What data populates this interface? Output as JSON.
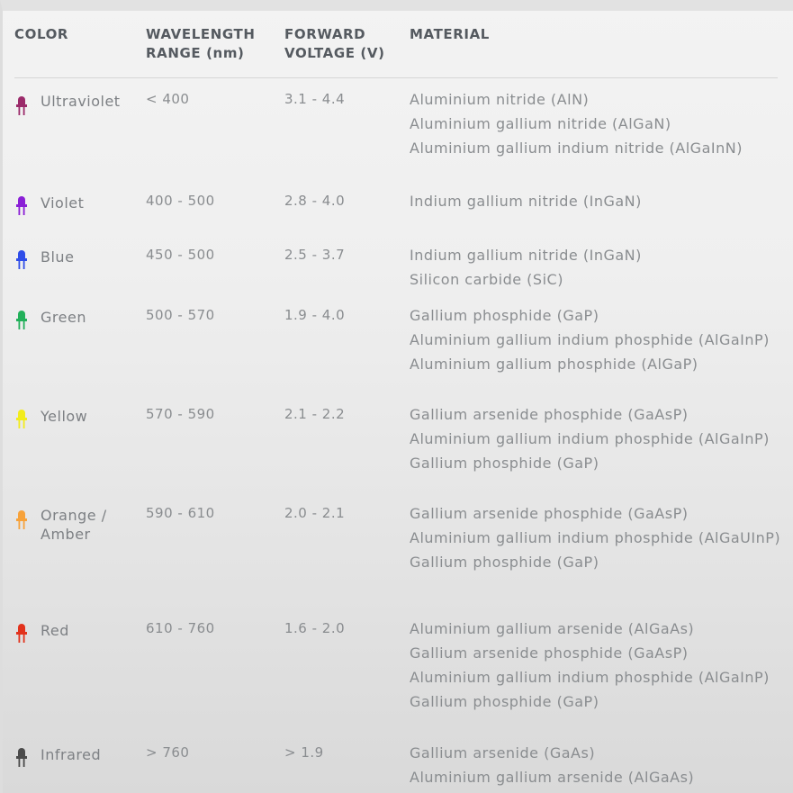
{
  "headers": {
    "color": [
      "COLOR"
    ],
    "wavelength": [
      "WAVELENGTH",
      "RANGE (nm)"
    ],
    "voltage": [
      "FORWARD",
      "VOLTAGE (V)"
    ],
    "material": [
      "MATERIAL"
    ]
  },
  "rows": [
    {
      "name": "Ultraviolet",
      "led_color": "#9b2a6a",
      "wavelength": "< 400",
      "voltage": "3.1 - 4.4",
      "materials": [
        "Aluminium nitride (AlN)",
        "Aluminium gallium nitride (AlGaN)",
        "Aluminium gallium indium nitride (AlGaInN)"
      ]
    },
    {
      "name": "Violet",
      "led_color": "#8a1fd6",
      "wavelength": "400 - 500",
      "voltage": "2.8 - 4.0",
      "materials": [
        "Indium gallium nitride (InGaN)"
      ]
    },
    {
      "name": "Blue",
      "led_color": "#2f4de8",
      "wavelength": "450 - 500",
      "voltage": "2.5 - 3.7",
      "materials": [
        "Indium gallium nitride (InGaN)",
        "Silicon carbide (SiC)"
      ]
    },
    {
      "name": "Green",
      "led_color": "#22b05a",
      "wavelength": "500 - 570",
      "voltage": "1.9 - 4.0",
      "materials": [
        "Gallium phosphide (GaP)",
        "Aluminium gallium indium phosphide (AlGaInP)",
        "Aluminium gallium phosphide (AlGaP)"
      ]
    },
    {
      "name": "Yellow",
      "led_color": "#f2ec1c",
      "wavelength": "570 - 590",
      "voltage": "2.1 - 2.2",
      "materials": [
        "Gallium arsenide phosphide (GaAsP)",
        "Aluminium gallium indium phosphide (AlGaInP)",
        "Gallium phosphide (GaP)"
      ]
    },
    {
      "name": "Orange / Amber",
      "led_color": "#f7a23a",
      "wavelength": "590 - 610",
      "voltage": "2.0 - 2.1",
      "materials": [
        "Gallium arsenide phosphide (GaAsP)",
        "Aluminium gallium indium phosphide (AlGaUInP)",
        "Gallium phosphide (GaP)"
      ]
    },
    {
      "name": "Red",
      "led_color": "#e2321c",
      "wavelength": "610 - 760",
      "voltage": "1.6 - 2.0",
      "materials": [
        "Aluminium gallium arsenide (AlGaAs)",
        "Gallium arsenide phosphide (GaAsP)",
        "Aluminium gallium indium phosphide (AlGaInP)",
        "Gallium phosphide (GaP)"
      ]
    },
    {
      "name": "Infrared",
      "led_color": "#4a4a4a",
      "wavelength": "> 760",
      "voltage": "> 1.9",
      "materials": [
        "Gallium arsenide (GaAs)",
        "Aluminium gallium arsenide (AlGaAs)"
      ]
    }
  ]
}
